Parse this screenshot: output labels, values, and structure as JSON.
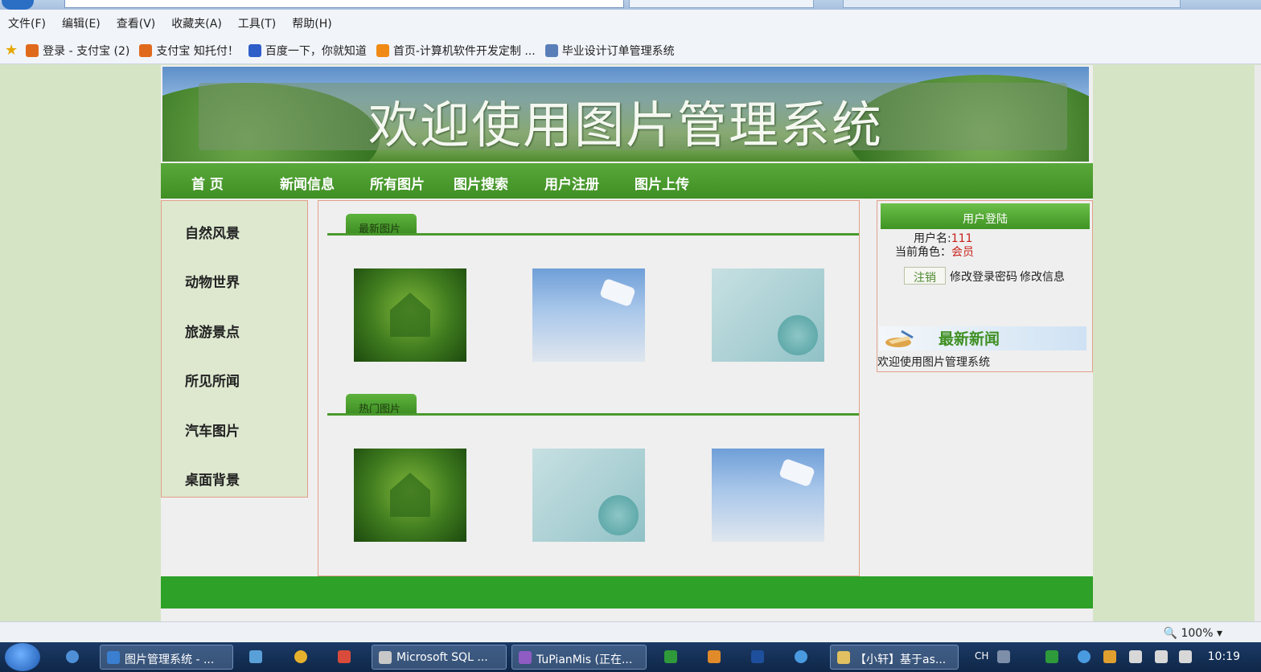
{
  "menubar": [
    "文件(F)",
    "编辑(E)",
    "查看(V)",
    "收藏夹(A)",
    "工具(T)",
    "帮助(H)"
  ],
  "favorites": [
    {
      "label": "登录 - 支付宝 (2)",
      "color": "#e06a1c"
    },
    {
      "label": "支付宝 知托付！",
      "color": "#e06a1c"
    },
    {
      "label": "百度一下，你就知道",
      "color": "#2e5fc9"
    },
    {
      "label": "首页-计算机软件开发定制 ...",
      "color": "#f08a14"
    },
    {
      "label": "毕业设计订单管理系统",
      "color": "#5a7fb8"
    }
  ],
  "banner": {
    "title": "欢迎使用图片管理系统"
  },
  "nav": [
    "首 页",
    "新闻信息",
    "所有图片",
    "图片搜索",
    "用户注册",
    "图片上传"
  ],
  "categories": [
    "自然风景",
    "动物世界",
    "旅游景点",
    "所见所闻",
    "汽车图片",
    "桌面背景"
  ],
  "sections": {
    "latest": {
      "label": "最新图片",
      "images": [
        "house-butterfly",
        "sky-love",
        "teal-flower"
      ]
    },
    "hot": {
      "label": "热门图片",
      "images": [
        "house-butterfly",
        "teal-flower",
        "sky-love"
      ]
    }
  },
  "login": {
    "title": "用户登陆",
    "username_label": "用户名:",
    "username": "111",
    "role_label": "当前角色：",
    "role": "会员",
    "logout": "注销",
    "change_password": "修改登录密码",
    "edit_info": "修改信息"
  },
  "news": {
    "title": "最新新闻",
    "items": [
      "欢迎使用图片管理系统"
    ]
  },
  "statusbar": {
    "zoom": "100%"
  },
  "taskbar": {
    "tasks": [
      "图片管理系统 - ...",
      "Microsoft SQL ...",
      "TuPianMis (正在...",
      "【小轩】基于as..."
    ],
    "lang": "CH",
    "clock": "10:19"
  },
  "colors": {
    "nav_green": "#4a9a2e",
    "footer_green": "#2ea128",
    "accent_red": "#c8201a",
    "border": "#e2a08a"
  }
}
